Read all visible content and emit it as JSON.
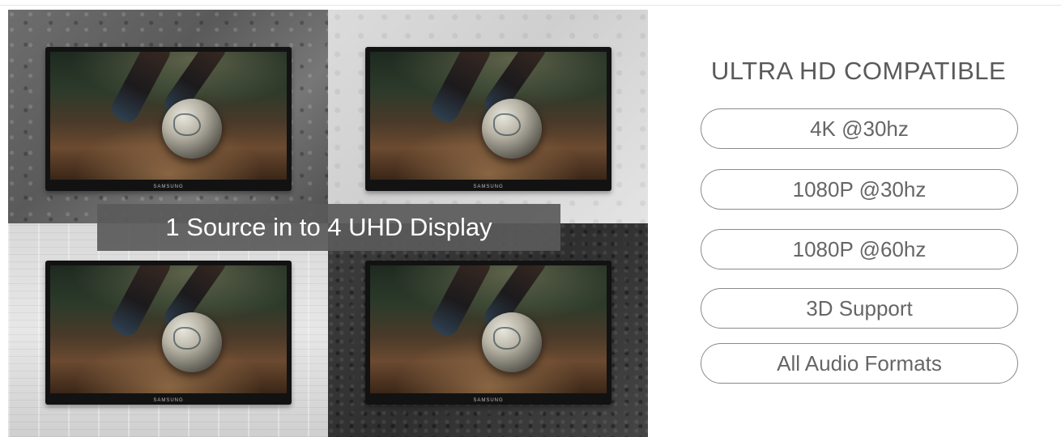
{
  "hero": {
    "caption": "1 Source in to 4 UHD Display",
    "tv_brand": "SAMSUNG",
    "screens": [
      {
        "position": "top-left",
        "wall": "dark-concrete"
      },
      {
        "position": "top-right",
        "wall": "light-concrete"
      },
      {
        "position": "bottom-left",
        "wall": "white-wood"
      },
      {
        "position": "bottom-right",
        "wall": "dark-stone"
      }
    ]
  },
  "features": {
    "title": "ULTRA HD COMPATIBLE",
    "items": [
      {
        "label": "4K @30hz"
      },
      {
        "label": "1080P @30hz"
      },
      {
        "label": "1080P @60hz"
      },
      {
        "label": "3D Support"
      },
      {
        "label": "All Audio Formats"
      }
    ]
  },
  "colors": {
    "caption_bg": "#5a5a5a",
    "caption_text": "#ffffff",
    "title_text": "#5a5a5a",
    "pill_border": "#8a8a8a"
  }
}
